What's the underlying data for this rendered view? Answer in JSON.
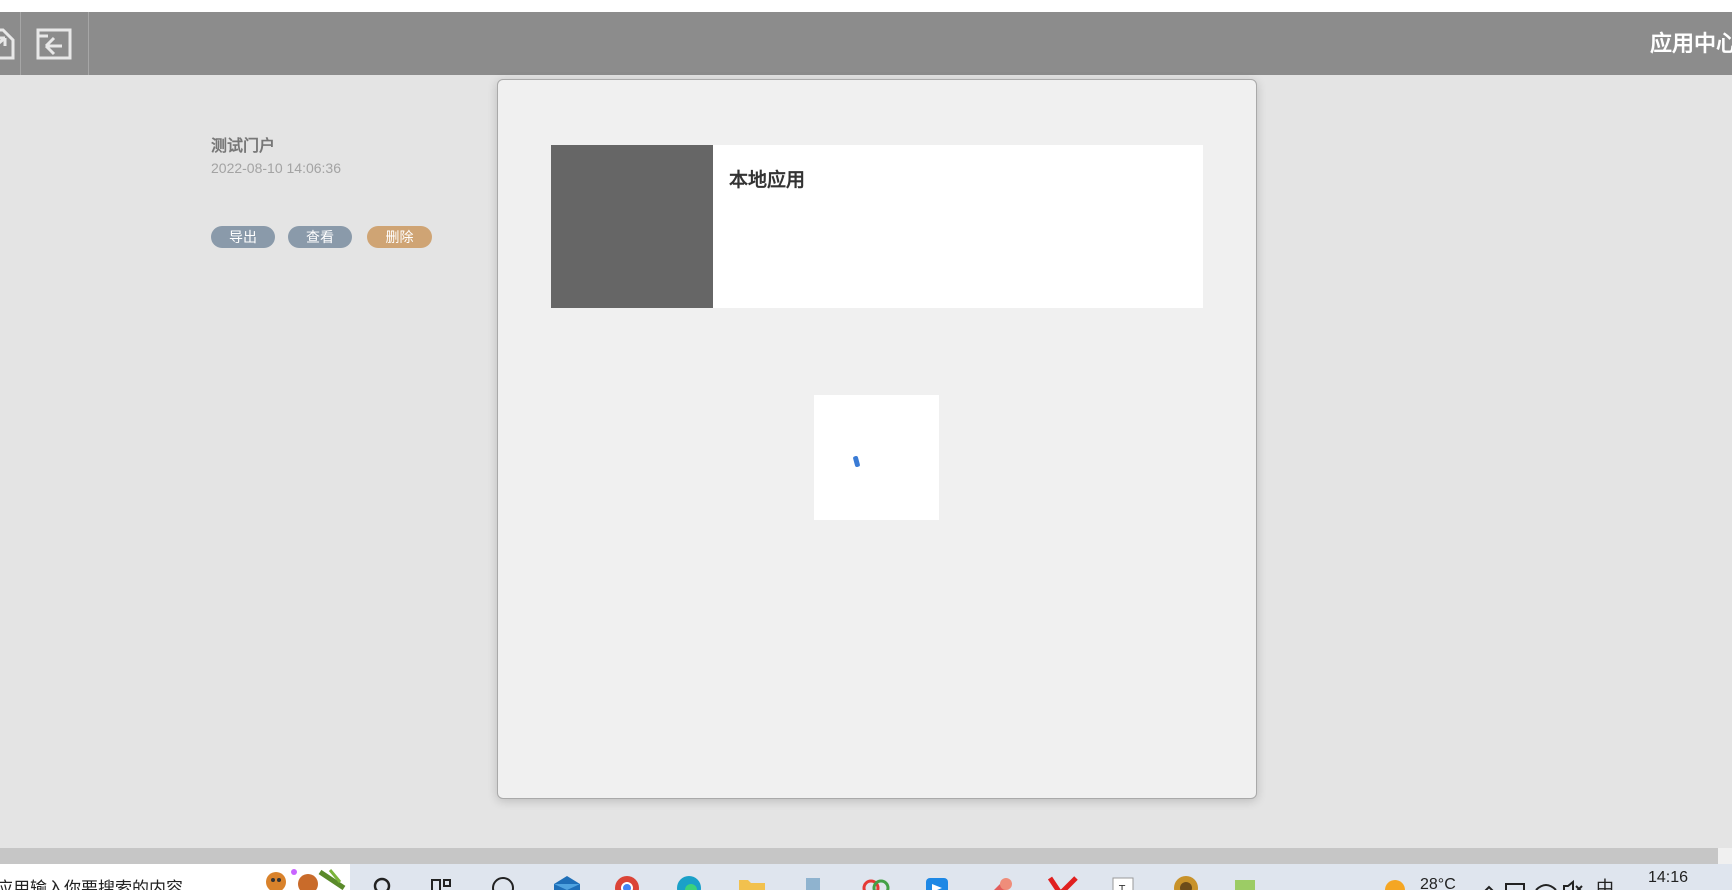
{
  "header": {
    "title": "应用中心",
    "buttons": [
      {
        "icon": "export-icon"
      },
      {
        "icon": "back-icon"
      }
    ]
  },
  "portal": {
    "title": "测试门户",
    "date": "2022-08-10 14:06:36",
    "actions": {
      "export": "导出",
      "view": "查看",
      "delete": "删除"
    },
    "colors": {
      "action": "#8a9aaa",
      "delete": "#cfa474"
    }
  },
  "modal": {
    "app_card": {
      "name": "本地应用"
    },
    "loader_icon": "spinner-icon"
  },
  "taskbar": {
    "search_text": "应用输入你要搜索的内容",
    "weather": "28°C",
    "time": "14:16",
    "ime": "中",
    "icons": [
      "search-icon",
      "taskview-icon",
      "app-icon",
      "mail-icon",
      "chrome-icon",
      "edge-icon",
      "folder-icon",
      "app-icon",
      "app-icon",
      "app-icon",
      "app-icon",
      "app-icon",
      "app-icon",
      "app-icon",
      "app-icon"
    ]
  }
}
